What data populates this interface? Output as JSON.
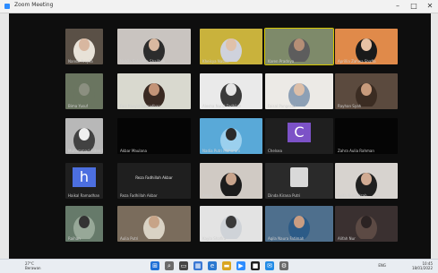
{
  "window": {
    "title": "Zoom Meeting",
    "minimize_glyph": "–",
    "maximize_glyph": "□",
    "close_glyph": "✕"
  },
  "participants": [
    {
      "name": "Nanda Arsyila",
      "kind": "video",
      "bg": "#5a5046",
      "face": "#d8b7a0",
      "hijab": "#e8e2d8"
    },
    {
      "name": "Nabila Salsabila Shalihah",
      "kind": "video",
      "bg": "#c9c4c0",
      "face": "#d9b8a0",
      "hijab": "#2c2c2c"
    },
    {
      "name": "Kheisya Nabila",
      "kind": "video",
      "bg": "#c9b23c",
      "face": "#e0c1aa",
      "hijab": "#cfd2dc"
    },
    {
      "name": "Karen Pradnya",
      "kind": "video",
      "bg": "#7e8a6a",
      "face": "#b58e76",
      "hijab": "#5d5d5d"
    },
    {
      "name": "Aprillia Zahwa Shaffa",
      "kind": "video",
      "bg": "#e08a4a",
      "face": "#e6c2a5",
      "hijab": "#1a1a1a"
    },
    {
      "name": "Bima Yusuf",
      "kind": "video",
      "bg": "#6a7560",
      "face": "#8b8f80",
      "hijab": "#6a7560"
    },
    {
      "name": "Faiz Rasyid Ramadhan",
      "kind": "video",
      "bg": "#d9d9cf",
      "face": "#c39477",
      "hijab": "#3a2a22"
    },
    {
      "name": "Alesha Nurul Fadhilah",
      "kind": "video",
      "bg": "#eaeaea",
      "face": "#e5e5e5",
      "hijab": "#3a3a3a"
    },
    {
      "name": "Faisal Pangestu",
      "kind": "video",
      "bg": "#eceae6",
      "face": "#ddbfa8",
      "hijab": "#8da0b5"
    },
    {
      "name": "Rayhan Syah",
      "kind": "video",
      "bg": "#5b4a3e",
      "face": "#c89b7c",
      "hijab": "#3b2c22"
    },
    {
      "name": "Muhammad Aiden Syafiq",
      "kind": "video",
      "bg": "#b8b8b8",
      "face": "#efefef",
      "hijab": "#424242"
    },
    {
      "name": "Akbar Maulana",
      "kind": "dark",
      "bg": "#050505"
    },
    {
      "name": "Nadia Putri Maharani",
      "kind": "video",
      "bg": "#59a9d8",
      "face": "#2b2b2b",
      "hijab": "#9bd0ee"
    },
    {
      "name": "Chelsea",
      "kind": "letter",
      "letter": "C",
      "bg": "#7c52c7"
    },
    {
      "name": "Zahra Aulia Rahman",
      "kind": "dark",
      "bg": "#050505"
    },
    {
      "name": "Haikal Ramadhan",
      "kind": "letter",
      "letter": "h",
      "bg": "#4c6fe0"
    },
    {
      "name": "Reza Fadhillah Akbar",
      "kind": "text",
      "overlay": "Reza Fadhillah Akbar",
      "bg": "#1f1f1f"
    },
    {
      "name": "Anisa",
      "kind": "video",
      "bg": "#d0cac4",
      "face": "#c8a48c",
      "hijab": "#1c1c1c"
    },
    {
      "name": "Dinda Kirana Putri",
      "kind": "silhouette",
      "bg": "#2a2a2a"
    },
    {
      "name": "Syifa Nur Azizah",
      "kind": "video",
      "bg": "#d7d3cf",
      "face": "#d1ab93",
      "hijab": "#202020"
    },
    {
      "name": "Raihan",
      "kind": "video",
      "bg": "#667a6a",
      "face": "#333333",
      "hijab": "#97a898"
    },
    {
      "name": "Aulia Putri",
      "kind": "video",
      "bg": "#7a6c5c",
      "face": "#c7a488",
      "hijab": "#d9d2c4"
    },
    {
      "name": "Kayla Shafira",
      "kind": "video",
      "bg": "#e3e3e3",
      "face": "#3a3a3a",
      "hijab": "#cfd3d8"
    },
    {
      "name": "Aqila Naura Fatimah",
      "kind": "video",
      "bg": "#4e6f8d",
      "face": "#c99d82",
      "hijab": "#2c5b87"
    },
    {
      "name": "Alifah Nur",
      "kind": "video",
      "bg": "#3a3030",
      "face": "#2b2323",
      "hijab": "#5c4a44"
    }
  ],
  "taskbar": {
    "weather_temp": "27°C",
    "weather_desc": "Berawan",
    "tray_lang": "ENG",
    "time": "10:45",
    "date": "18/01/2022"
  },
  "colors": {
    "active_speaker": "#d6c700",
    "zoom_blue": "#2d8cff"
  }
}
